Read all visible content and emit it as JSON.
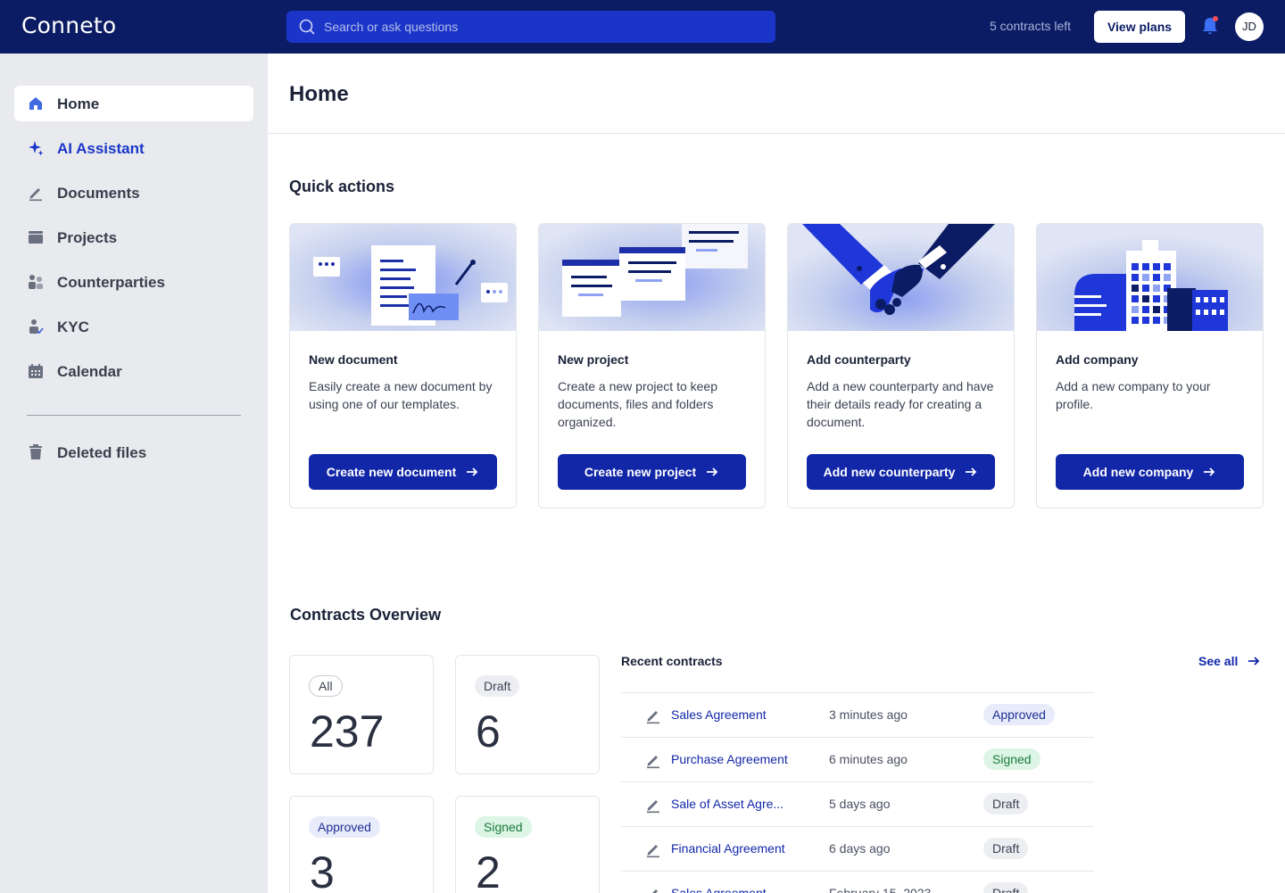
{
  "app": {
    "name": "Conneto"
  },
  "topbar": {
    "search_placeholder": "Search or ask questions",
    "contracts_left": "5 contracts left",
    "view_plans": "View plans",
    "avatar_initials": "JD"
  },
  "sidebar": {
    "items": [
      {
        "label": "Home",
        "icon": "home-icon"
      },
      {
        "label": "AI Assistant",
        "icon": "sparkle-icon"
      },
      {
        "label": "Documents",
        "icon": "pen-icon"
      },
      {
        "label": "Projects",
        "icon": "folder-icon"
      },
      {
        "label": "Counterparties",
        "icon": "people-icon"
      },
      {
        "label": "KYC",
        "icon": "user-check-icon"
      },
      {
        "label": "Calendar",
        "icon": "calendar-icon"
      }
    ],
    "deleted": {
      "label": "Deleted files",
      "icon": "trash-icon"
    }
  },
  "page": {
    "title": "Home"
  },
  "quick_actions": {
    "title": "Quick actions",
    "cards": [
      {
        "title": "New document",
        "desc": "Easily create a new document by using one of our templates.",
        "button": "Create new document"
      },
      {
        "title": "New project",
        "desc": "Create a new project to keep documents, files and folders organized.",
        "button": "Create new project"
      },
      {
        "title": "Add counterparty",
        "desc": "Add a new counterparty and have their details ready for creating a document.",
        "button": "Add new counterparty"
      },
      {
        "title": "Add company",
        "desc": "Add a new company to your profile.",
        "button": "Add new company"
      }
    ]
  },
  "overview": {
    "title": "Contracts Overview",
    "stats": [
      {
        "label": "All",
        "value": "237"
      },
      {
        "label": "Draft",
        "value": "6"
      },
      {
        "label": "Approved",
        "value": "3"
      },
      {
        "label": "Signed",
        "value": "2"
      }
    ],
    "recent": {
      "title": "Recent contracts",
      "see_all": "See all",
      "rows": [
        {
          "name": "Sales Agreement",
          "time": "3 minutes ago",
          "status": "Approved"
        },
        {
          "name": "Purchase Agreement",
          "time": "6 minutes ago",
          "status": "Signed"
        },
        {
          "name": "Sale of Asset Agre...",
          "time": "5 days ago",
          "status": "Draft"
        },
        {
          "name": "Financial Agreement",
          "time": "6 days ago",
          "status": "Draft"
        },
        {
          "name": "Sales Agreement",
          "time": "February 15, 2023",
          "status": "Draft"
        }
      ]
    }
  },
  "colors": {
    "topbar": "#0b1c64",
    "accent": "#1227a8",
    "search": "#1c35c9",
    "sidebar": "#e9eaed"
  }
}
